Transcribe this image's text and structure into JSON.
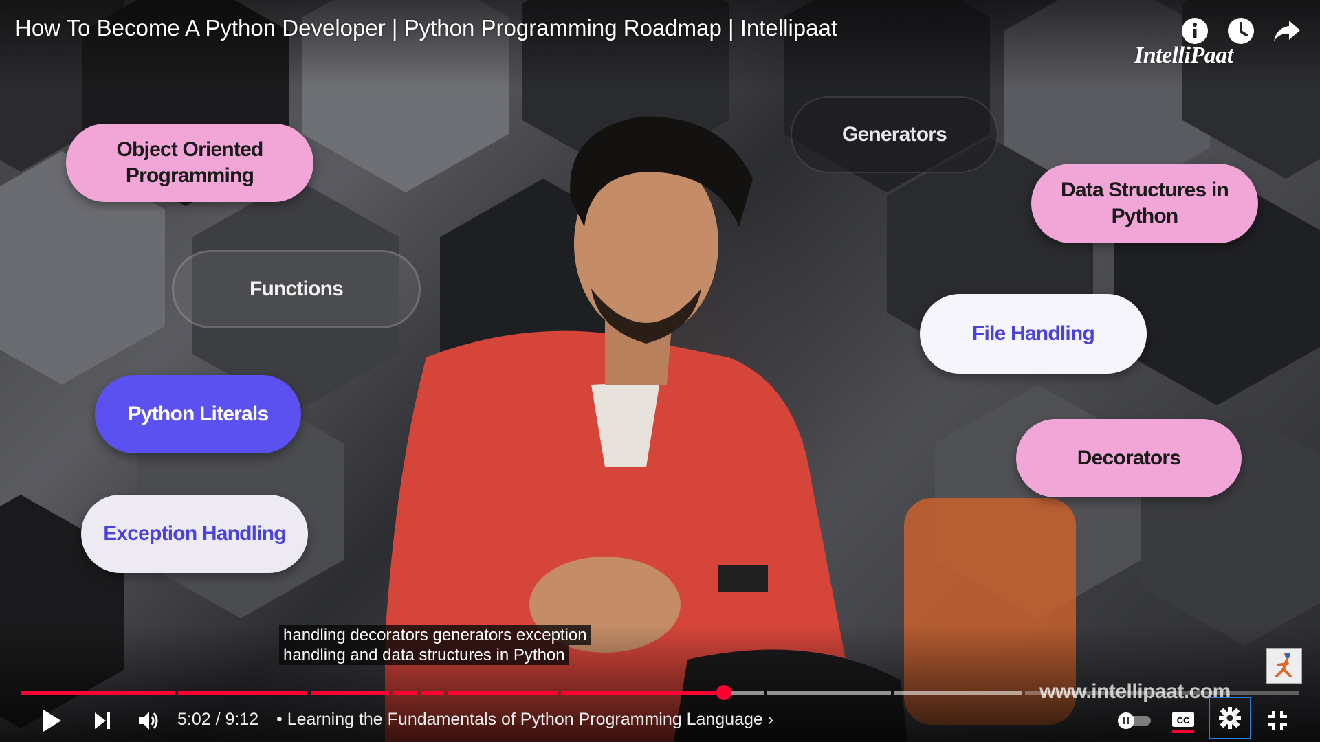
{
  "video": {
    "title": "How To Become A Python Developer | Python Programming Roadmap | Intellipaat",
    "brand_logo": "IntelliPaat",
    "website_watermark": "www.intellipaat.com"
  },
  "topic_pills": {
    "oop_line1": "Object Oriented",
    "oop_line2": "Programming",
    "generators": "Generators",
    "data_structures_line1": "Data Structures in",
    "data_structures_line2": "Python",
    "functions": "Functions",
    "file_handling": "File Handling",
    "python_literals": "Python Literals",
    "decorators": "Decorators",
    "exception_handling": "Exception Handling"
  },
  "captions": {
    "line1": "handling decorators generators exception",
    "line2": "handling and data structures in Python"
  },
  "player": {
    "current_time": "5:02",
    "duration": "9:12",
    "time_display": "5:02 / 9:12",
    "chapter_title": "• Learning the Fundamentals of Python Programming Language ›",
    "progress_fraction": 0.547,
    "autoplay": "paused",
    "captions_enabled": true,
    "accent_color": "#ff0033"
  },
  "icons": {
    "top_right": [
      "info-icon",
      "watch-later-clock-icon",
      "share-arrow-icon"
    ],
    "controls_left": [
      "play-icon",
      "next-icon",
      "volume-icon"
    ],
    "controls_right": [
      "autoplay-toggle-icon",
      "closed-captions-icon",
      "settings-gear-icon",
      "exit-fullscreen-icon"
    ]
  }
}
